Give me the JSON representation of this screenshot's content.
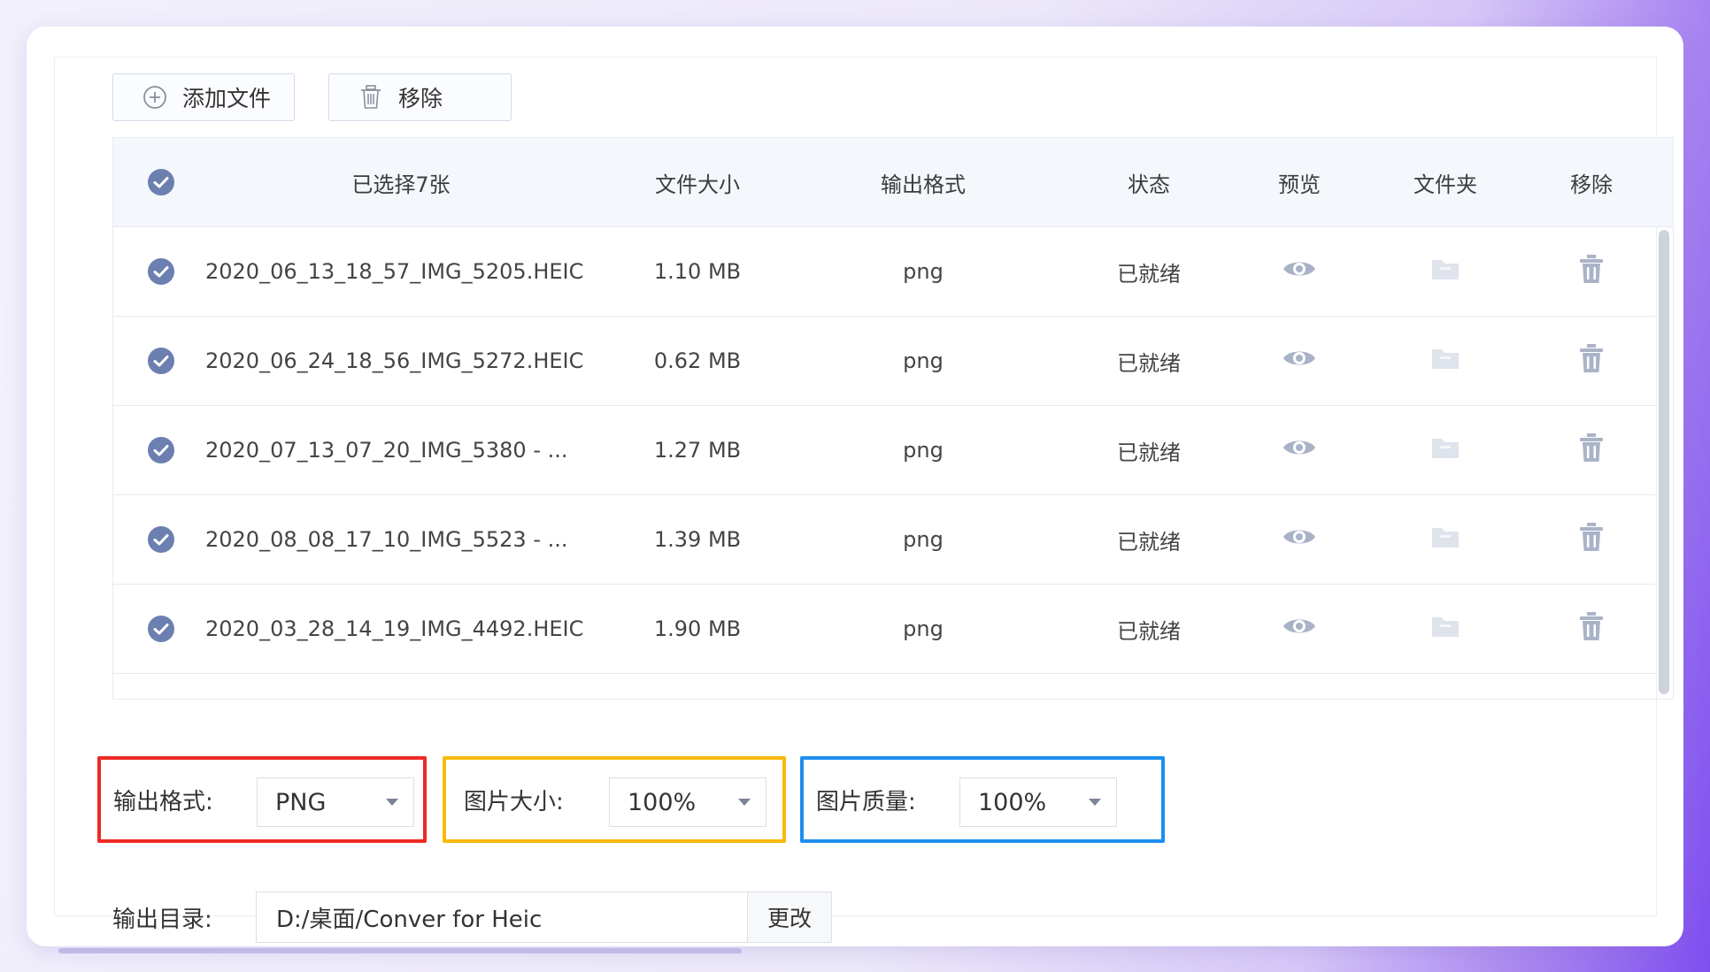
{
  "toolbar": {
    "add_label": "添加文件",
    "remove_label": "移除"
  },
  "table": {
    "headers": {
      "selected": "已选择7张",
      "size": "文件大小",
      "format": "输出格式",
      "status": "状态",
      "preview": "预览",
      "folder": "文件夹",
      "remove": "移除"
    },
    "rows": [
      {
        "name": "2020_06_13_18_57_IMG_5205.HEIC",
        "size": "1.10 MB",
        "format": "png",
        "status": "已就绪"
      },
      {
        "name": "2020_06_24_18_56_IMG_5272.HEIC",
        "size": "0.62 MB",
        "format": "png",
        "status": "已就绪"
      },
      {
        "name": "2020_07_13_07_20_IMG_5380 - ...",
        "size": "1.27 MB",
        "format": "png",
        "status": "已就绪"
      },
      {
        "name": "2020_08_08_17_10_IMG_5523 - ...",
        "size": "1.39 MB",
        "format": "png",
        "status": "已就绪"
      },
      {
        "name": "2020_03_28_14_19_IMG_4492.HEIC",
        "size": "1.90 MB",
        "format": "png",
        "status": "已就绪"
      }
    ]
  },
  "options": {
    "format_label": "输出格式:",
    "format_value": "PNG",
    "size_label": "图片大小:",
    "size_value": "100%",
    "quality_label": "图片质量:",
    "quality_value": "100%"
  },
  "output": {
    "label": "输出目录:",
    "path": "D:/桌面/Conver for Heic",
    "change_label": "更改"
  },
  "colors": {
    "accent": "#6b7fb0",
    "highlight_red": "#ee2a24",
    "highlight_yellow": "#f8b90c",
    "highlight_blue": "#1e8ef0"
  }
}
